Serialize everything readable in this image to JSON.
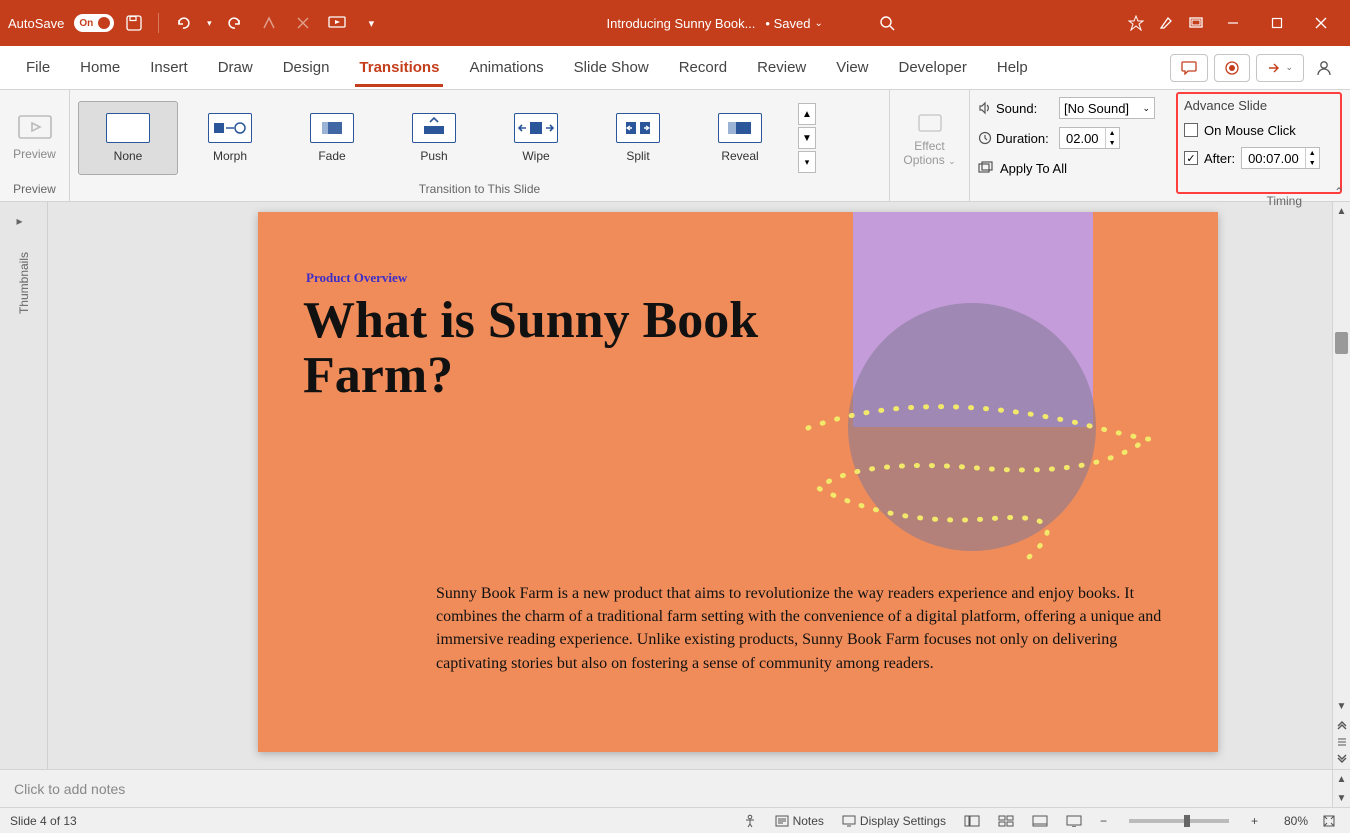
{
  "titlebar": {
    "autosave_label": "AutoSave",
    "autosave_state": "On",
    "doc_title": "Introducing Sunny Book...",
    "saved_label": "• Saved"
  },
  "tabs": {
    "items": [
      "File",
      "Home",
      "Insert",
      "Draw",
      "Design",
      "Transitions",
      "Animations",
      "Slide Show",
      "Record",
      "Review",
      "View",
      "Developer",
      "Help"
    ],
    "active_index": 5
  },
  "ribbon": {
    "preview": {
      "label": "Preview",
      "group_label": "Preview"
    },
    "transitions": {
      "group_label": "Transition to This Slide",
      "items": [
        "None",
        "Morph",
        "Fade",
        "Push",
        "Wipe",
        "Split",
        "Reveal"
      ],
      "selected_index": 0
    },
    "effect": {
      "line1": "Effect",
      "line2": "Options"
    },
    "timing": {
      "group_label": "Timing",
      "sound_label": "Sound:",
      "sound_value": "[No Sound]",
      "duration_label": "Duration:",
      "duration_value": "02.00",
      "apply_all_label": "Apply To All",
      "advance_title": "Advance Slide",
      "on_click_label": "On Mouse Click",
      "on_click_checked": false,
      "after_label": "After:",
      "after_checked": true,
      "after_value": "00:07.00"
    }
  },
  "thumb_rail": {
    "label": "Thumbnails"
  },
  "slide": {
    "overline": "Product Overview",
    "title": "What is Sunny Book Farm?",
    "body": "Sunny Book Farm is a new product that aims to revolutionize the way readers experience and enjoy books. It combines the charm of a traditional farm setting with the convenience of a digital platform, offering a unique and immersive reading experience. Unlike existing products, Sunny Book Farm focuses not only on delivering captivating stories but also on fostering a sense of community among readers."
  },
  "notes": {
    "placeholder": "Click to add notes"
  },
  "statusbar": {
    "slide_info": "Slide 4 of 13",
    "notes_label": "Notes",
    "display_settings_label": "Display Settings",
    "zoom_label": "80%"
  }
}
